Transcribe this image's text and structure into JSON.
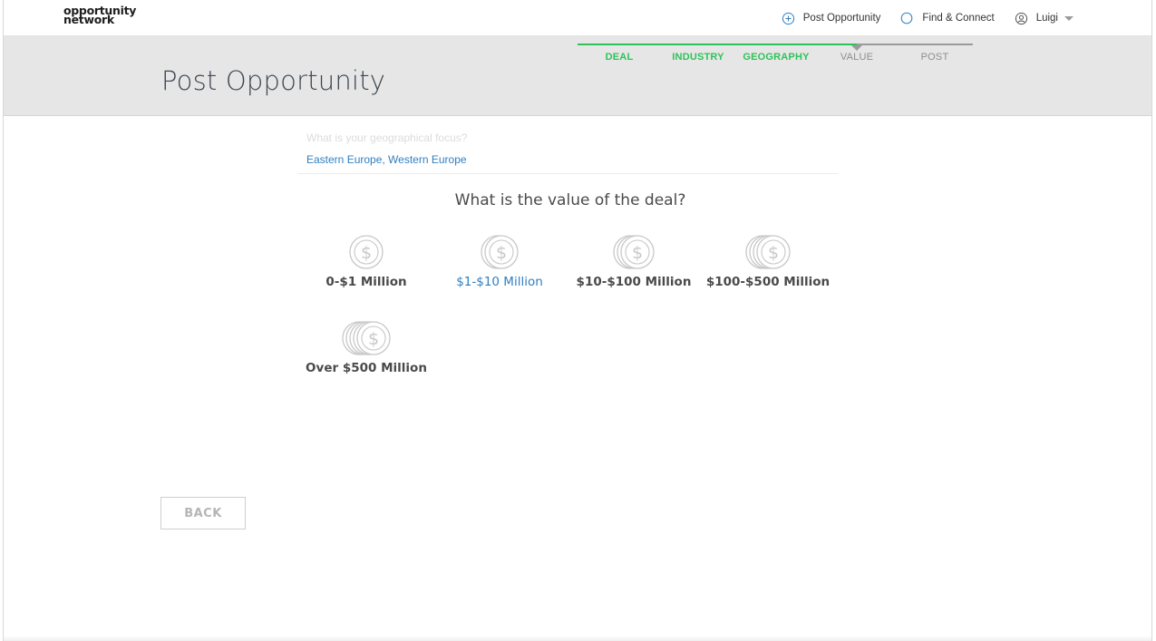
{
  "brand": {
    "line1": "opportunity",
    "line2": "network"
  },
  "nav": {
    "post_opportunity": "Post Opportunity",
    "find_connect": "Find & Connect",
    "user_name": "Luigi"
  },
  "header": {
    "title": "Post Opportunity"
  },
  "steps": [
    {
      "label": "DEAL",
      "status": "done"
    },
    {
      "label": "INDUSTRY",
      "status": "done"
    },
    {
      "label": "GEOGRAPHY",
      "status": "done"
    },
    {
      "label": "VALUE",
      "status": "current"
    },
    {
      "label": "POST",
      "status": "todo"
    }
  ],
  "previous": {
    "question": "What is your geographical focus?",
    "answer": "Eastern Europe, Western Europe"
  },
  "question": "What is the value of the deal?",
  "options": [
    {
      "label": "0-$1 Million",
      "coins": 1,
      "selected": false
    },
    {
      "label": "$1-$10 Million",
      "coins": 2,
      "selected": true
    },
    {
      "label": "$10-$100 Million",
      "coins": 3,
      "selected": false
    },
    {
      "label": "$100-$500 Million",
      "coins": 4,
      "selected": false
    },
    {
      "label": "Over $500 Million",
      "coins": 5,
      "selected": false
    }
  ],
  "back_label": "BACK",
  "colors": {
    "accent_green": "#2fc25b",
    "link_blue": "#2f7fc1",
    "coin_gray": "#c8c8c8"
  }
}
